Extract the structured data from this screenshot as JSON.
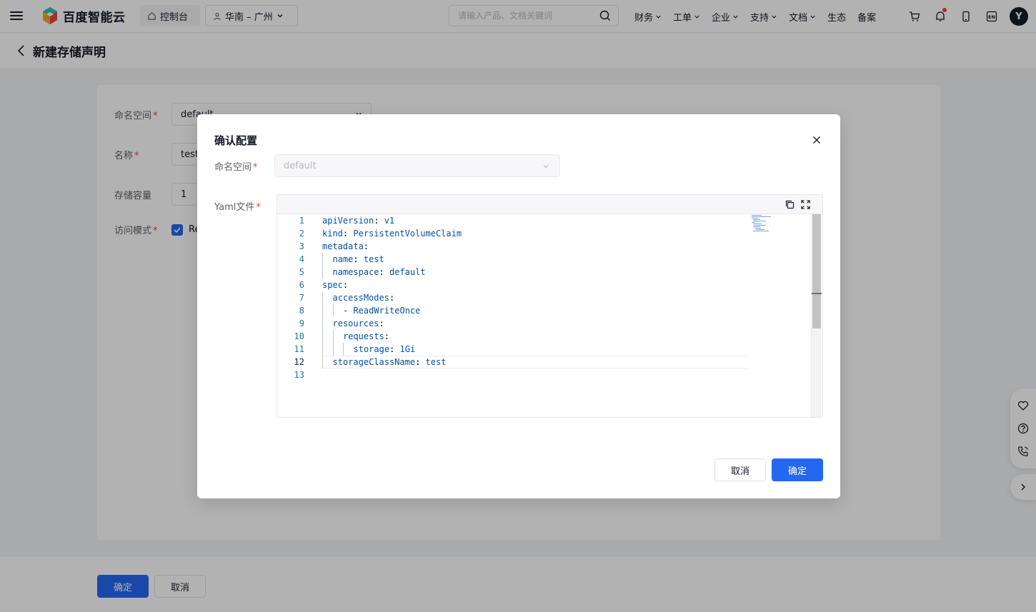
{
  "topnav": {
    "brand": "百度智能云",
    "console_label": "控制台",
    "region_label": "华南 – 广州",
    "search_placeholder": "请输入产品、文档关键词",
    "menu": [
      {
        "label": "财务",
        "has_dropdown": true
      },
      {
        "label": "工单",
        "has_dropdown": true
      },
      {
        "label": "企业",
        "has_dropdown": true
      },
      {
        "label": "支持",
        "has_dropdown": true
      },
      {
        "label": "文档",
        "has_dropdown": true
      },
      {
        "label": "生态",
        "has_dropdown": false
      },
      {
        "label": "备案",
        "has_dropdown": false
      }
    ],
    "lang_label": "EN",
    "avatar_initial": "Y"
  },
  "page": {
    "title": "新建存储声明"
  },
  "form": {
    "namespace_label": "命名空间",
    "namespace_value": "default",
    "name_label": "名称",
    "name_value": "test",
    "capacity_label": "存储容量",
    "capacity_value": "1",
    "access_mode_label": "访问模式",
    "access_mode_value": "Re",
    "access_mode_checked": true,
    "required_mark": "*"
  },
  "footer": {
    "confirm_label": "确定",
    "cancel_label": "取消"
  },
  "modal": {
    "title": "确认配置",
    "namespace_label": "命名空间",
    "namespace_value": "default",
    "yaml_label": "Yaml文件",
    "required_mark": "*",
    "active_line": 12,
    "code_lines": [
      {
        "n": "1",
        "indent": 0,
        "key": "apiVersion",
        "value": "v1"
      },
      {
        "n": "2",
        "indent": 0,
        "key": "kind",
        "value": "PersistentVolumeClaim"
      },
      {
        "n": "3",
        "indent": 0,
        "key": "metadata",
        "value": ""
      },
      {
        "n": "4",
        "indent": 1,
        "key": "name",
        "value": "test"
      },
      {
        "n": "5",
        "indent": 1,
        "key": "namespace",
        "value": "default"
      },
      {
        "n": "6",
        "indent": 0,
        "key": "spec",
        "value": ""
      },
      {
        "n": "7",
        "indent": 1,
        "key": "accessModes",
        "value": ""
      },
      {
        "n": "8",
        "indent": 2,
        "key": "",
        "value": "- ReadWriteOnce"
      },
      {
        "n": "9",
        "indent": 1,
        "key": "resources",
        "value": ""
      },
      {
        "n": "10",
        "indent": 2,
        "key": "requests",
        "value": ""
      },
      {
        "n": "11",
        "indent": 3,
        "key": "storage",
        "value": "1Gi"
      },
      {
        "n": "12",
        "indent": 1,
        "key": "storageClassName",
        "value": "test"
      },
      {
        "n": "13",
        "indent": 0,
        "key": "",
        "value": ""
      }
    ],
    "cancel_label": "取消",
    "confirm_label": "确定"
  },
  "colors": {
    "primary": "#2468f2",
    "required": "#f33e3e",
    "yaml_key": "#0451a5",
    "line_number": "#237893"
  },
  "icons": {
    "menu": "hamburger-icon",
    "home": "home-icon",
    "region": "location-icon",
    "search": "search-icon",
    "cart": "cart-icon",
    "bell": "bell-icon",
    "phone": "phone-icon",
    "lang": "language-icon",
    "back": "chevron-left-icon",
    "close": "close-icon",
    "copy": "copy-icon",
    "fullscreen": "fullscreen-icon",
    "favorite": "heart-icon",
    "help": "help-icon",
    "contact": "phone-call-icon",
    "expand": "chevron-right-icon"
  }
}
